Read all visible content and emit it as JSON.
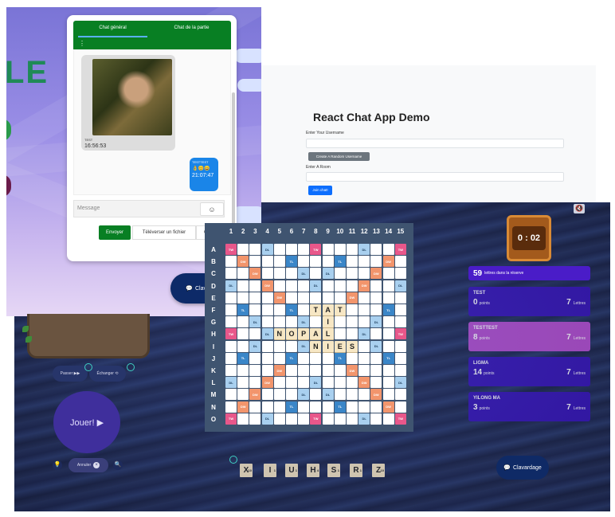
{
  "react_demo": {
    "title": "React Chat App Demo",
    "username_label": "Enter Your Username",
    "random_username_button": "Create A Random Username",
    "room_label": "Enter A Room",
    "join_button": "Join chat!"
  },
  "chat": {
    "tabs": [
      "Chat général",
      "Chat de la partie"
    ],
    "active_tab": 0,
    "menu_icon": "⋮",
    "messages": [
      {
        "author": "TEST",
        "time": "16:56:53",
        "has_image": true
      },
      {
        "author": "TESTTEST",
        "emojis": "👌😊😄",
        "time": "21:07:47"
      }
    ],
    "input_placeholder": "Message",
    "emoji_icon": "☺",
    "send_button": "Envoyer",
    "upload_button": "Téléverser un fichier",
    "gif_button": "GIF",
    "toggle_button": "Clavardage"
  },
  "logo_text": "LE",
  "game": {
    "timer": "0 : 02",
    "reserve_count": "59",
    "reserve_label": "lettres dans la réserve",
    "players": [
      {
        "name": "TEST",
        "points": "0",
        "letters": "7",
        "active": false
      },
      {
        "name": "TESTTEST",
        "points": "8",
        "letters": "7",
        "active": true
      },
      {
        "name": "LIGMA",
        "points": "14",
        "letters": "7",
        "active": false
      },
      {
        "name": "YILONG MA",
        "points": "3",
        "letters": "7",
        "active": false
      }
    ],
    "points_label": "points",
    "letters_label": "Lettres",
    "pass_button": "Passer ▶▶",
    "swap_button": "Échanger ⟲",
    "play_button": "Jouer! ▶",
    "cancel_button": "Annuler",
    "chat_button": "Clavardage",
    "rack": [
      {
        "letter": "X",
        "value": "10"
      },
      {
        "letter": "I",
        "value": "1"
      },
      {
        "letter": "U",
        "value": "1"
      },
      {
        "letter": "H",
        "value": "4"
      },
      {
        "letter": "S",
        "value": "1"
      },
      {
        "letter": "R",
        "value": "1"
      },
      {
        "letter": "Z",
        "value": "10"
      }
    ],
    "columns": [
      "1",
      "2",
      "3",
      "4",
      "5",
      "6",
      "7",
      "8",
      "9",
      "10",
      "11",
      "12",
      "13",
      "14",
      "15"
    ],
    "rows": [
      "A",
      "B",
      "C",
      "D",
      "E",
      "F",
      "G",
      "H",
      "I",
      "J",
      "K",
      "L",
      "M",
      "N",
      "O"
    ],
    "premium_labels": {
      "tw": "TW",
      "dw": "DW",
      "tl": "TL",
      "dl": "DL"
    },
    "placed_tiles": [
      {
        "row": 5,
        "col": 7,
        "letter": "T"
      },
      {
        "row": 5,
        "col": 8,
        "letter": "A"
      },
      {
        "row": 5,
        "col": 9,
        "letter": "T"
      },
      {
        "row": 6,
        "col": 8,
        "letter": "I"
      },
      {
        "row": 7,
        "col": 4,
        "letter": "N"
      },
      {
        "row": 7,
        "col": 5,
        "letter": "O"
      },
      {
        "row": 7,
        "col": 6,
        "letter": "P"
      },
      {
        "row": 7,
        "col": 7,
        "letter": "A"
      },
      {
        "row": 7,
        "col": 8,
        "letter": "L"
      },
      {
        "row": 8,
        "col": 7,
        "letter": "N"
      },
      {
        "row": 8,
        "col": 8,
        "letter": "I"
      },
      {
        "row": 8,
        "col": 9,
        "letter": "E"
      },
      {
        "row": 8,
        "col": 10,
        "letter": "S"
      }
    ]
  }
}
